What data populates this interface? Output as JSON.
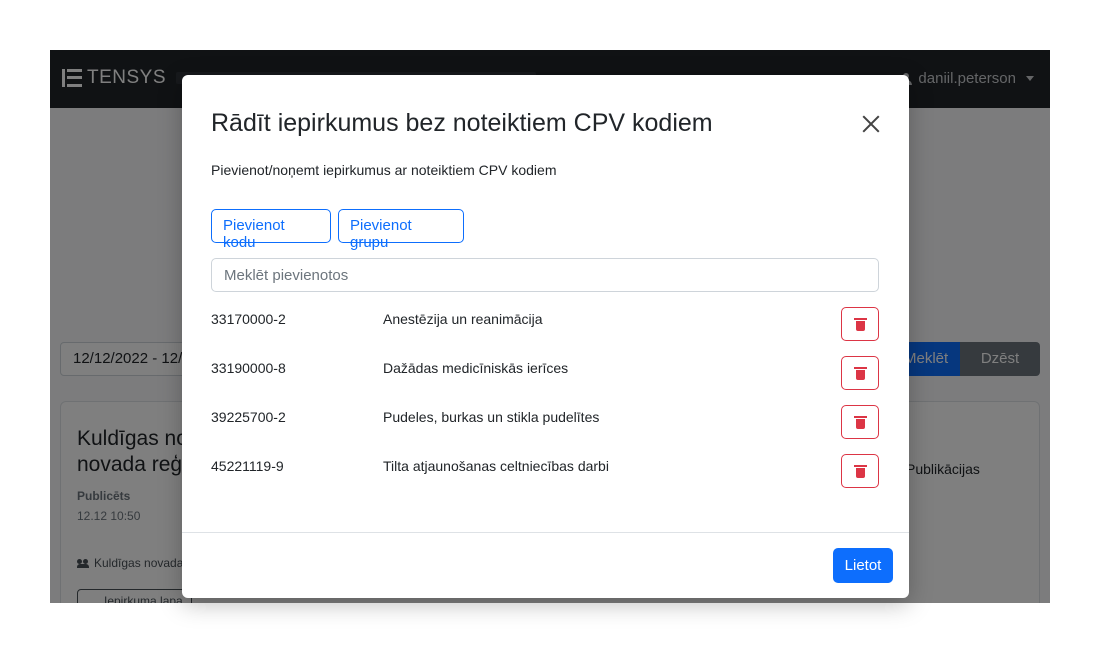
{
  "app": {
    "brand": "TENSYS",
    "user": "daniil.peterson"
  },
  "search_bar": {
    "date_range": "12/12/2022 - 12/",
    "search_label": "Meklēt",
    "clear_label": "Dzēst"
  },
  "result": {
    "title": "Kuldīgas no\nnovada reģ",
    "published_label": "Publicēts",
    "published_date": "12.12 10:50",
    "organization": "Kuldīgas novada",
    "procurement_link": "Iepirkuma lapa",
    "publications_label": "Publikācijas"
  },
  "modal": {
    "title": "Rādīt iepirkumus bez noteiktiem CPV kodiem",
    "subtitle": "Pievienot/noņemt iepirkumus ar noteiktiem CPV kodiem",
    "add_code_label": "Pievienot kodu",
    "add_group_label": "Pievienot grupu",
    "search_placeholder": "Meklēt pievienotos",
    "codes": [
      {
        "code": "33170000-2",
        "description": "Anestēzija un reanimācija"
      },
      {
        "code": "33190000-8",
        "description": "Dažādas medicīniskās ierīces"
      },
      {
        "code": "39225700-2",
        "description": "Pudeles, burkas un stikla pudelītes"
      },
      {
        "code": "45221119-9",
        "description": "Tilta atjaunošanas celtniecības darbi"
      }
    ],
    "apply_label": "Lietot"
  }
}
